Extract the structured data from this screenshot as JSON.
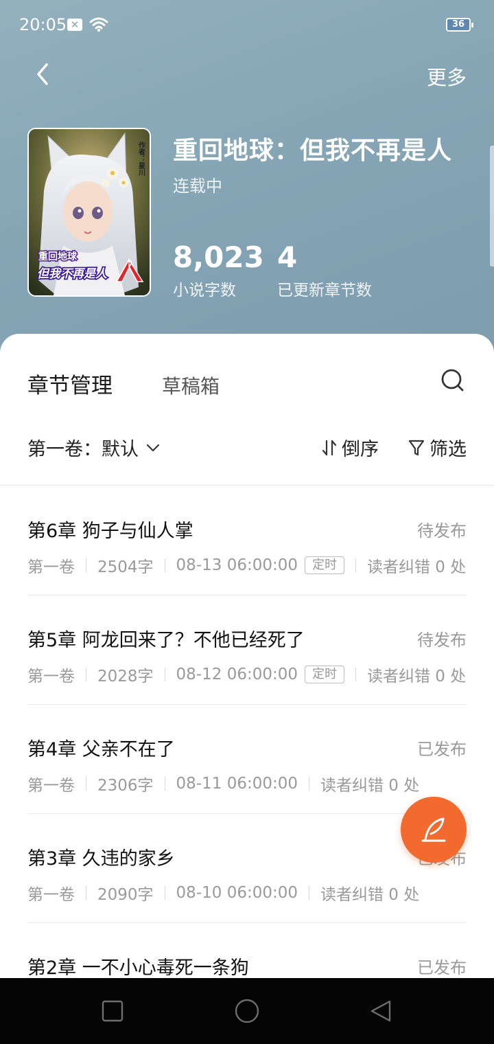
{
  "status_bar": {
    "time": "20:05",
    "notification_badge": "✕",
    "battery": "36"
  },
  "header": {
    "more_label": "更多"
  },
  "book": {
    "title": "重回地球：但我不再是人",
    "status": "连载中",
    "cover_text_line1": "重回地球",
    "cover_text_line2": "但我不再是人",
    "cover_author": "作者：星川",
    "word_count": "8,023",
    "word_count_label": "小说字数",
    "updated_chapters": "4",
    "updated_chapters_label": "已更新章节数"
  },
  "tabs": {
    "chapters": "章节管理",
    "drafts": "草稿箱"
  },
  "toolbar": {
    "volume": "第一卷：默认",
    "sort": "倒序",
    "filter": "筛选"
  },
  "chapters": [
    {
      "title": "第6章 狗子与仙人掌",
      "status": "待发布",
      "volume": "第一卷",
      "words": "2504字",
      "time": "08-13 06:00:00",
      "tag": "定时",
      "errors": "读者纠错 0 处"
    },
    {
      "title": "第5章 阿龙回来了？不他已经死了",
      "status": "待发布",
      "volume": "第一卷",
      "words": "2028字",
      "time": "08-12 06:00:00",
      "tag": "定时",
      "errors": "读者纠错 0 处"
    },
    {
      "title": "第4章 父亲不在了",
      "status": "已发布",
      "volume": "第一卷",
      "words": "2306字",
      "time": "08-11 06:00:00",
      "tag": "",
      "errors": "读者纠错 0 处"
    },
    {
      "title": "第3章 久违的家乡",
      "status": "已发布",
      "volume": "第一卷",
      "words": "2090字",
      "time": "08-10 06:00:00",
      "tag": "",
      "errors": "读者纠错 0 处"
    },
    {
      "title": "第2章 一不小心毒死一条狗",
      "status": "已发布",
      "volume": "",
      "words": "",
      "time": "",
      "tag": "",
      "errors": ""
    }
  ],
  "colors": {
    "header_bg": "#8aa8b6",
    "accent": "#f26a2e",
    "nav_bar": "#050505"
  },
  "icons": {
    "back": "chevron-left-icon",
    "search": "search-icon",
    "sort": "sort-arrows-icon",
    "filter": "funnel-icon",
    "fab": "quill-pen-icon"
  }
}
